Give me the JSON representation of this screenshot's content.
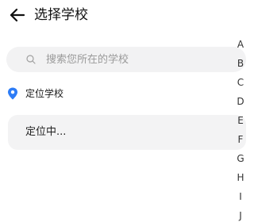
{
  "header": {
    "title": "选择学校",
    "back_icon": "arrow-left-icon"
  },
  "search": {
    "placeholder": "搜索您所在的学校",
    "value": "",
    "icon": "search-icon"
  },
  "location": {
    "label": "定位学校",
    "icon": "map-pin-icon",
    "status": "定位中..."
  },
  "alphabet_index": [
    "A",
    "B",
    "C",
    "D",
    "E",
    "F",
    "G",
    "H",
    "I",
    "J"
  ],
  "colors": {
    "accent": "#2d7cf6",
    "field_background": "#f2f2f3",
    "placeholder": "#9a9a9a"
  }
}
